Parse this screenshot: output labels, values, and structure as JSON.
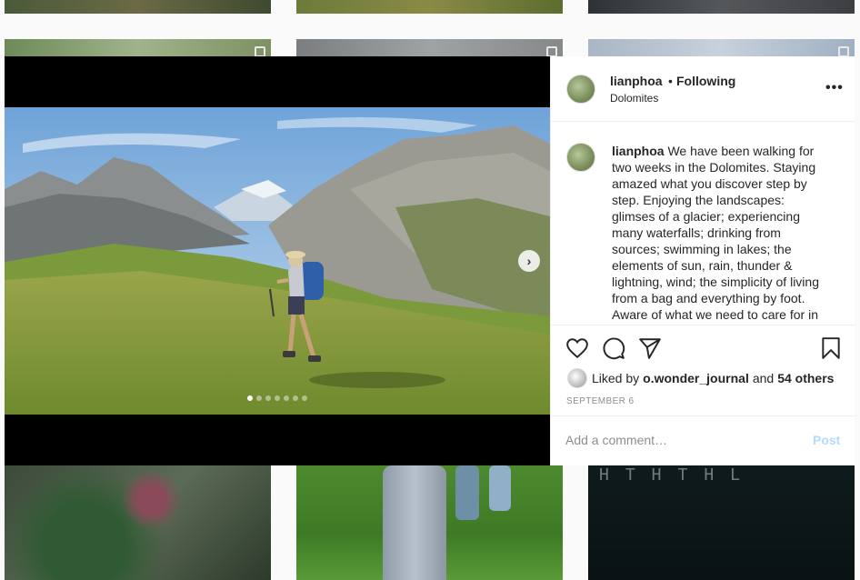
{
  "post": {
    "username": "lianphoa",
    "separator": "•",
    "follow_status": "Following",
    "location": "Dolomites",
    "more_label": "•••",
    "caption_user": "lianphoa",
    "caption_text": " We have been walking for two weeks in the Dolomites. Staying amazed what you discover step by step. Enjoying the landscapes: glimses of a glacier; experiencing many waterfalls; drinking from sources; swimming in lakes; the elements of sun, rain, thunder & lightning, wind; the simplicity of living from a bag and everything by foot. Aware of what we need to care for in our lives and in our world.",
    "liked_by_prefix": "Liked by",
    "liked_user": "o.wonder_journal",
    "liked_and": "and",
    "liked_count": "54 others",
    "date": "SEPTEMBER 6",
    "comment_placeholder": "Add a comment…",
    "post_button": "Post",
    "carousel": {
      "total": 7,
      "active_index": 0
    }
  },
  "icons": {
    "next": "chevron-right-icon",
    "like": "heart-icon",
    "comment": "comment-icon",
    "share": "paper-plane-icon",
    "save": "bookmark-icon"
  },
  "background_grid": {
    "t9_text": "HTHTHL"
  }
}
